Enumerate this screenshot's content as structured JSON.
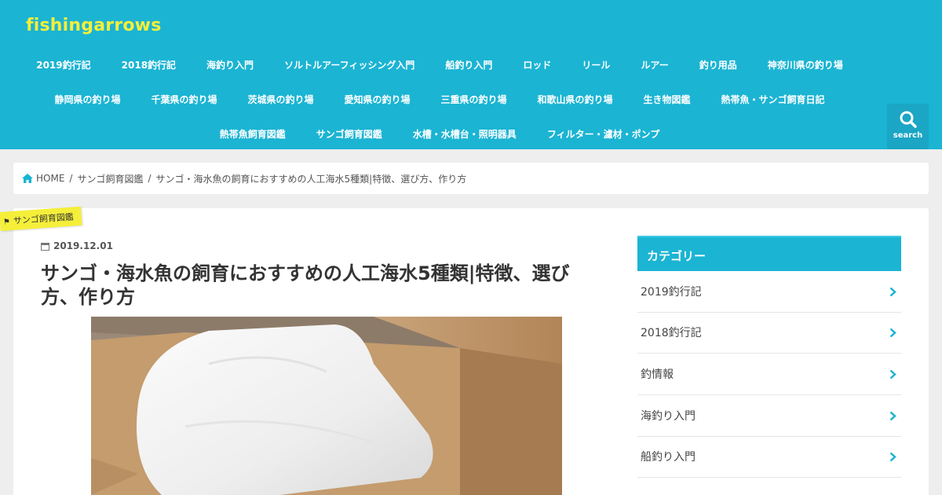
{
  "site": {
    "logo": "fishingarrows"
  },
  "nav": {
    "row1": [
      "2019釣行記",
      "2018釣行記",
      "海釣り入門",
      "ソルトルアーフィッシング入門",
      "船釣り入門",
      "ロッド",
      "リール",
      "ルアー",
      "釣り用品",
      "神奈川県の釣り場"
    ],
    "row2": [
      "静岡県の釣り場",
      "千葉県の釣り場",
      "茨城県の釣り場",
      "愛知県の釣り場",
      "三重県の釣り場",
      "和歌山県の釣り場",
      "生き物図鑑",
      "熱帯魚・サンゴ飼育日記"
    ],
    "row3": [
      "熱帯魚飼育図鑑",
      "サンゴ飼育図鑑",
      "水槽・水槽台・照明器具",
      "フィルター・濾材・ポンプ"
    ]
  },
  "search": {
    "label": "search",
    "icon": "search-icon"
  },
  "breadcrumb": {
    "home": "HOME",
    "category": "サンゴ飼育図鑑",
    "current": "サンゴ・海水魚の飼育におすすめの人工海水5種類|特徴、選び方、作り方"
  },
  "post": {
    "category_label": "サンゴ飼育図鑑",
    "date": "2019.12.01",
    "title": "サンゴ・海水魚の飼育におすすめの人工海水5種類|特徴、選び方、作り方"
  },
  "sidebar": {
    "heading": "カテゴリー",
    "items": [
      "2019釣行記",
      "2018釣行記",
      "釣情報",
      "海釣り入門",
      "船釣り入門"
    ]
  },
  "colors": {
    "header_bg": "#1bb4d3",
    "logo": "#f5ef3a",
    "label_bg": "#f5ef3a",
    "chevron": "#1bb4d3"
  }
}
